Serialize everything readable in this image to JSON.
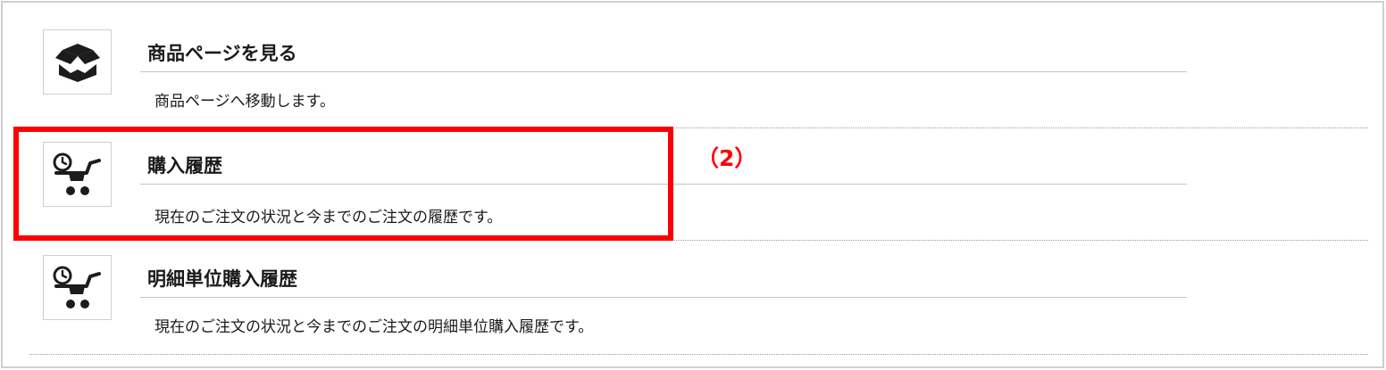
{
  "items": [
    {
      "title": "商品ページを見る",
      "description": "商品ページへ移動します。",
      "icon": "box-icon"
    },
    {
      "title": "購入履歴",
      "description": "現在のご注文の状況と今までのご注文の履歴です。",
      "icon": "cart-history-icon"
    },
    {
      "title": "明細単位購入履歴",
      "description": "現在のご注文の状況と今までのご注文の明細単位購入履歴です。",
      "icon": "cart-history-icon"
    }
  ],
  "annotation": {
    "callout_label": "（2）",
    "color": "#ff0000"
  }
}
